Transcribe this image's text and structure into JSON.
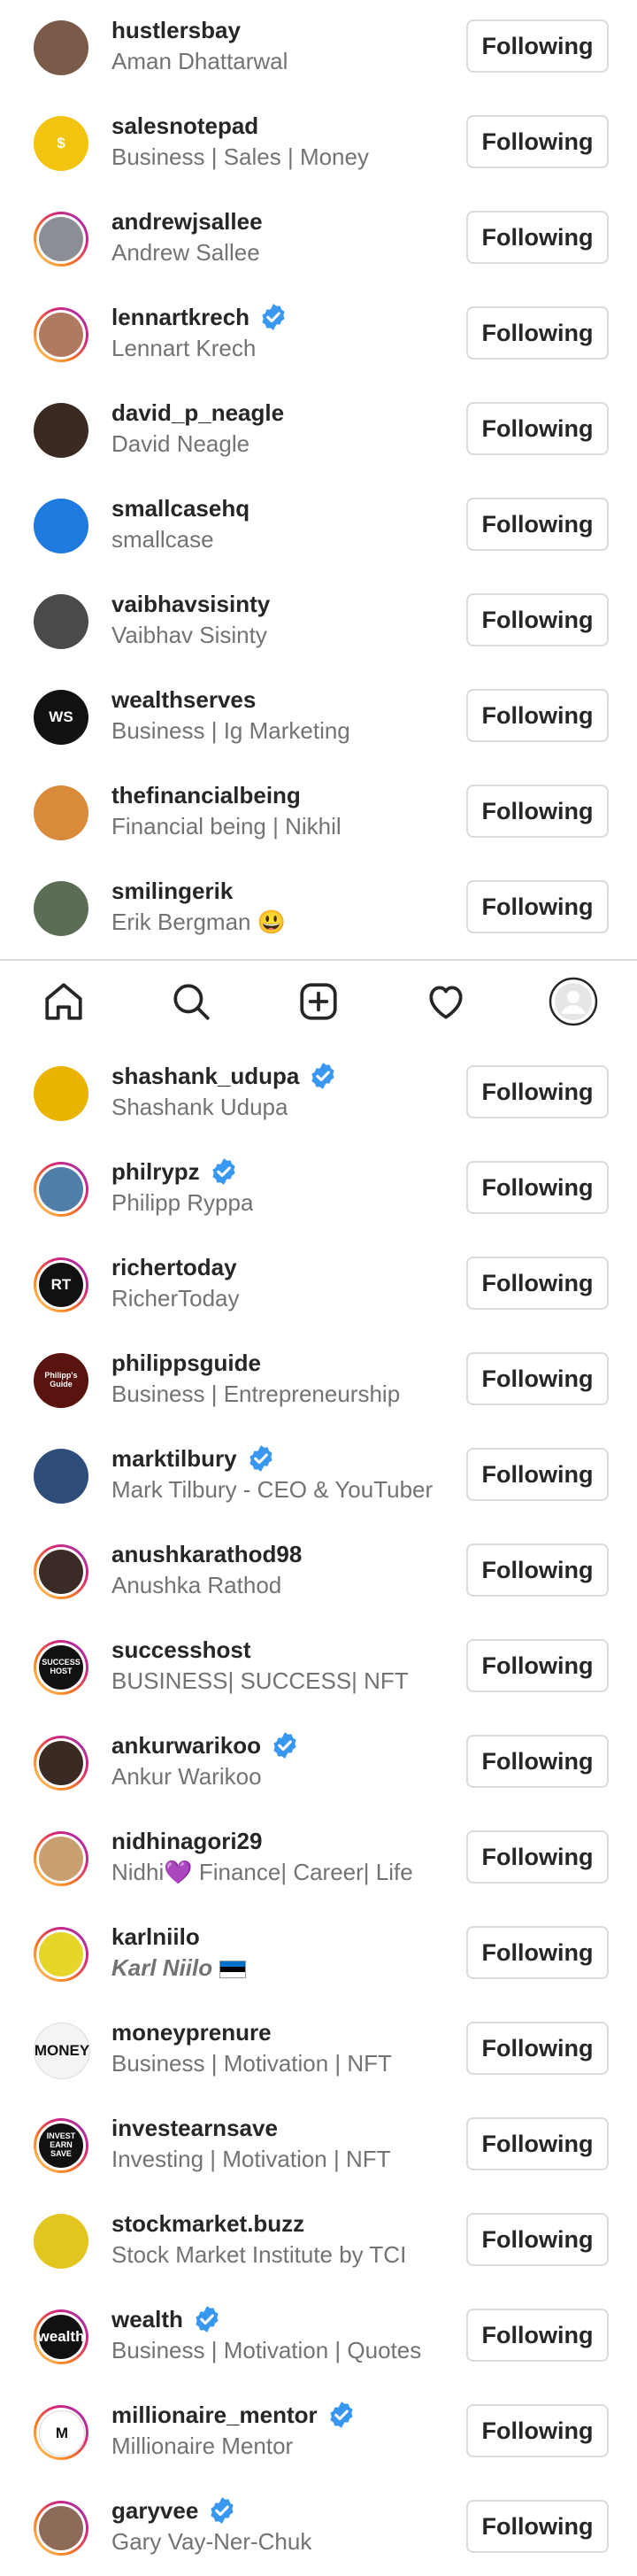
{
  "labels": {
    "following": "Following"
  },
  "top_list": [
    {
      "username": "hustlersbay",
      "subtitle": "Aman Dhattarwal",
      "verified": false,
      "ring": false,
      "avatar_text": "",
      "avatar_color": "#7a5a48"
    },
    {
      "username": "salesnotepad",
      "subtitle": "Business | Sales | Money",
      "verified": false,
      "ring": false,
      "avatar_text": "$",
      "avatar_color": "#f2c40f"
    },
    {
      "username": "andrewjsallee",
      "subtitle": "Andrew Sallee",
      "verified": false,
      "ring": true,
      "avatar_text": "",
      "avatar_color": "#8a8f96"
    },
    {
      "username": "lennartkrech",
      "subtitle": "Lennart Krech",
      "verified": true,
      "ring": true,
      "avatar_text": "",
      "avatar_color": "#b07a60"
    },
    {
      "username": "david_p_neagle",
      "subtitle": "David Neagle",
      "verified": false,
      "ring": false,
      "avatar_text": "",
      "avatar_color": "#3b2a22"
    },
    {
      "username": "smallcasehq",
      "subtitle": "smallcase",
      "verified": false,
      "ring": false,
      "avatar_text": "",
      "avatar_color": "#1f7ae0"
    },
    {
      "username": "vaibhavsisinty",
      "subtitle": "Vaibhav Sisinty",
      "verified": false,
      "ring": false,
      "avatar_text": "",
      "avatar_color": "#4a4a4a"
    },
    {
      "username": "wealthserves",
      "subtitle": "Business | Ig Marketing",
      "verified": false,
      "ring": false,
      "avatar_text": "WS",
      "avatar_color": "#111111"
    },
    {
      "username": "thefinancialbeing",
      "subtitle": "Financial being | Nikhil",
      "verified": false,
      "ring": false,
      "avatar_text": "",
      "avatar_color": "#d98a3a"
    },
    {
      "username": "smilingerik",
      "subtitle": "Erik Bergman 😃",
      "verified": false,
      "ring": false,
      "avatar_text": "",
      "avatar_color": "#5b6e55"
    }
  ],
  "nav": [
    "home-icon",
    "search-icon",
    "create-icon",
    "heart-icon",
    "profile-icon"
  ],
  "bottom_list": [
    {
      "username": "shashank_udupa",
      "subtitle": "Shashank Udupa",
      "verified": true,
      "ring": false,
      "avatar_text": "",
      "avatar_color": "#e8b400"
    },
    {
      "username": "philrypz",
      "subtitle": "Philipp Ryppa",
      "verified": true,
      "ring": true,
      "avatar_text": "",
      "avatar_color": "#4f7fa8"
    },
    {
      "username": "richertoday",
      "subtitle": "RicherToday",
      "verified": false,
      "ring": true,
      "avatar_text": "RT",
      "avatar_color": "#111111"
    },
    {
      "username": "philippsguide",
      "subtitle": "Business | Entrepreneurship",
      "verified": false,
      "ring": false,
      "avatar_text": "Philipp's Guide",
      "avatar_color": "#5a1410"
    },
    {
      "username": "marktilbury",
      "subtitle": "Mark Tilbury - CEO & YouTuber",
      "verified": true,
      "ring": false,
      "avatar_text": "",
      "avatar_color": "#2e4d7a"
    },
    {
      "username": "anushkarathod98",
      "subtitle": "Anushka Rathod",
      "verified": false,
      "ring": true,
      "avatar_text": "",
      "avatar_color": "#3a2b26"
    },
    {
      "username": "successhost",
      "subtitle": "BUSINESS| SUCCESS| NFT",
      "verified": false,
      "ring": true,
      "avatar_text": "SUCCESS HOST",
      "avatar_color": "#111111"
    },
    {
      "username": "ankurwarikoo",
      "subtitle": "Ankur Warikoo",
      "verified": true,
      "ring": true,
      "avatar_text": "",
      "avatar_color": "#3a2a24"
    },
    {
      "username": "nidhinagori29",
      "subtitle": "Nidhi💜 Finance| Career| Life",
      "verified": false,
      "ring": true,
      "avatar_text": "",
      "avatar_color": "#c8a070"
    },
    {
      "username": "karlniilo",
      "subtitle": "Karl Niilo",
      "verified": false,
      "ring": true,
      "italic": true,
      "flag": true,
      "avatar_text": "",
      "avatar_color": "#e6d62a"
    },
    {
      "username": "moneyprenure",
      "subtitle": "Business | Motivation | NFT",
      "verified": false,
      "ring": false,
      "avatar_text": "MONEY",
      "avatar_color": "#f4f4f4"
    },
    {
      "username": "investearnsave",
      "subtitle": "Investing | Motivation | NFT",
      "verified": false,
      "ring": true,
      "avatar_text": "INVEST EARN SAVE",
      "avatar_color": "#111111"
    },
    {
      "username": "stockmarket.buzz",
      "subtitle": "Stock Market Institute by TCI",
      "verified": false,
      "ring": false,
      "avatar_text": "",
      "avatar_color": "#e3c520"
    },
    {
      "username": "wealth",
      "subtitle": "Business | Motivation | Quotes",
      "verified": true,
      "ring": true,
      "avatar_text": "wealth",
      "avatar_color": "#111111"
    },
    {
      "username": "millionaire_mentor",
      "subtitle": "Millionaire Mentor",
      "verified": true,
      "ring": true,
      "avatar_text": "M",
      "avatar_color": "#ffffff"
    },
    {
      "username": "garyvee",
      "subtitle": "Gary Vay-Ner-Chuk",
      "verified": true,
      "ring": true,
      "avatar_text": "",
      "avatar_color": "#8d6b58"
    }
  ]
}
